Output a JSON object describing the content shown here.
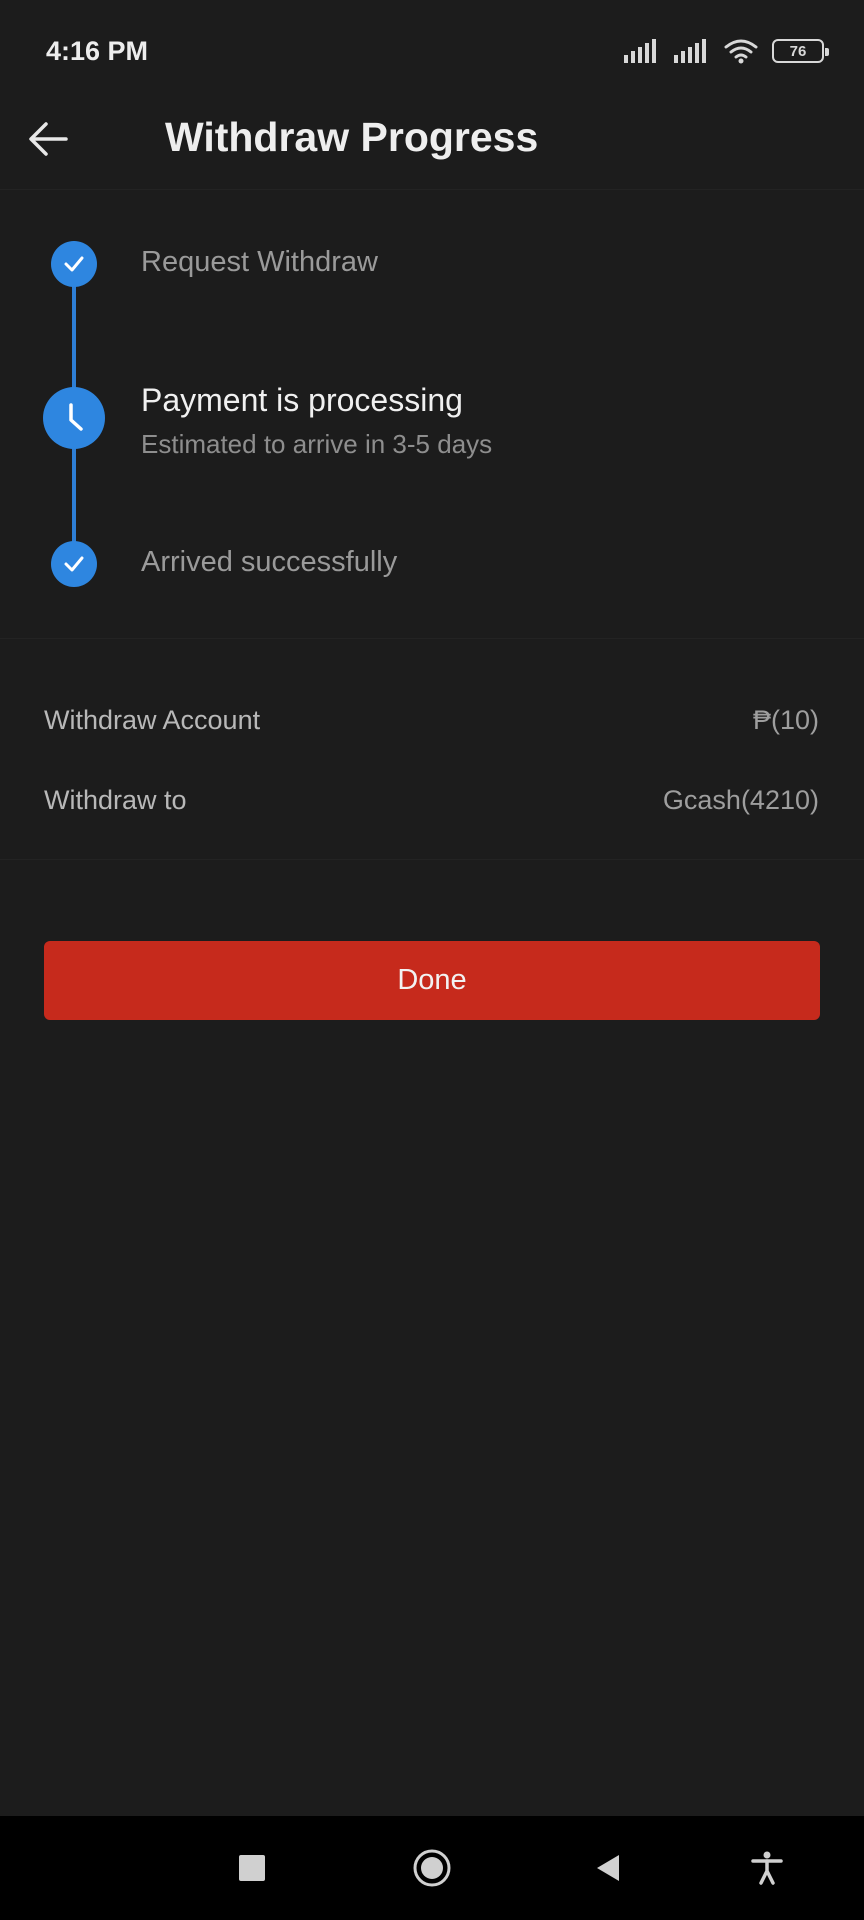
{
  "status_bar": {
    "time": "4:16 PM",
    "battery": "76",
    "icons": [
      "signal-icon",
      "signal-icon",
      "wifi-icon",
      "battery-icon"
    ]
  },
  "header": {
    "title": "Withdraw Progress",
    "back_icon": "arrow-left-icon"
  },
  "steps": [
    {
      "label": "Request Withdraw",
      "icon": "check-icon",
      "state": "done"
    },
    {
      "label": "Payment is processing",
      "subtitle": "Estimated to arrive in 3-5 days",
      "icon": "clock-icon",
      "state": "active"
    },
    {
      "label": "Arrived successfully",
      "icon": "check-icon",
      "state": "done"
    }
  ],
  "details": [
    {
      "label": "Withdraw Account",
      "value": "₱(10)"
    },
    {
      "label": "Withdraw to",
      "value": "Gcash(4210)"
    }
  ],
  "done_button": {
    "label": "Done"
  },
  "nav_bar": {
    "buttons": [
      "recents-square-icon",
      "home-circle-icon",
      "back-triangle-icon",
      "accessibility-icon"
    ]
  },
  "colors": {
    "background": "#1c1c1c",
    "accent_blue": "#2e86e0",
    "button_red": "#c62a1c"
  }
}
